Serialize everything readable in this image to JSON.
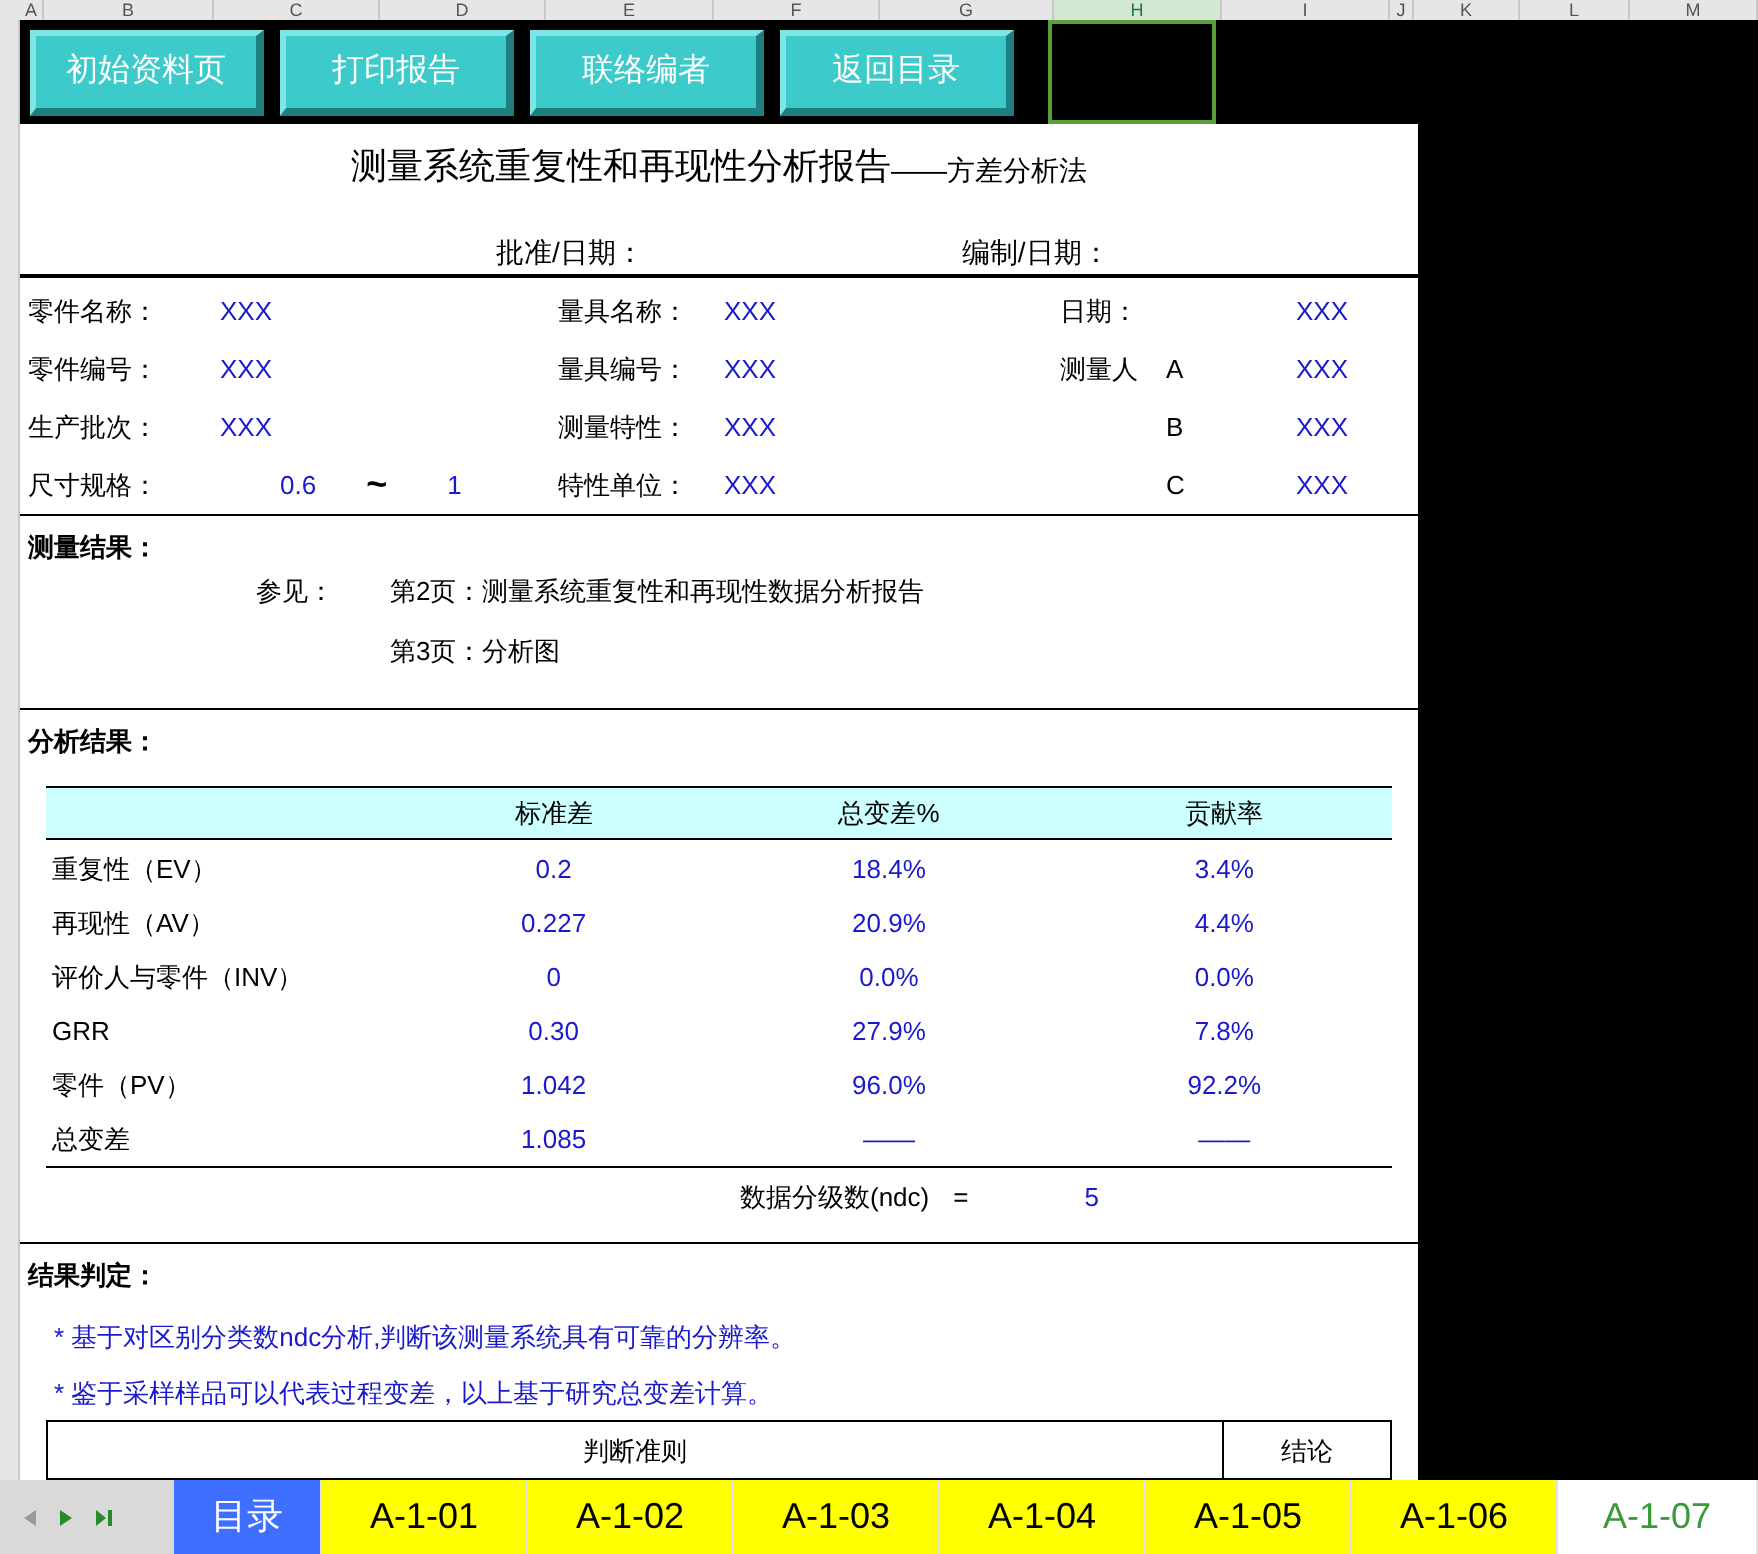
{
  "column_headers": [
    {
      "label": "A",
      "selected": false
    },
    {
      "label": "B",
      "selected": false
    },
    {
      "label": "C",
      "selected": false
    },
    {
      "label": "D",
      "selected": false
    },
    {
      "label": "E",
      "selected": false
    },
    {
      "label": "F",
      "selected": false
    },
    {
      "label": "G",
      "selected": false
    },
    {
      "label": "H",
      "selected": true
    },
    {
      "label": "I",
      "selected": false
    },
    {
      "label": "J",
      "selected": false
    },
    {
      "label": "K",
      "selected": false
    },
    {
      "label": "L",
      "selected": false
    },
    {
      "label": "M",
      "selected": false
    }
  ],
  "buttons": [
    "初始资料页",
    "打印报告",
    "联络编者",
    "返回目录"
  ],
  "title": "测量系统重复性和再现性分析报告",
  "subtitle": "——方差分析法",
  "approval": [
    "批准/日期：",
    "编制/日期："
  ],
  "info_rows": [
    {
      "left_label": "零件名称：",
      "left_value": "XXX",
      "mid_label": "量具名称：",
      "mid_value": "XXX",
      "right_label": "日期：",
      "right_value": "XXX"
    },
    {
      "left_label": "零件编号：",
      "left_value": "XXX",
      "mid_label": "量具编号：",
      "mid_value": "XXX",
      "right_label": "测量人",
      "right_sub": "A",
      "right_value": "XXX"
    },
    {
      "left_label": "生产批次：",
      "left_value": "XXX",
      "mid_label": "测量特性：",
      "mid_value": "XXX",
      "right_sub": "B",
      "right_value": "XXX"
    },
    {
      "left_label": "尺寸规格：",
      "spec_min": "0.6",
      "spec_tilde": "~",
      "spec_max": "1",
      "mid_label": "特性单位：",
      "mid_value": "XXX",
      "right_sub": "C",
      "right_value": "XXX"
    }
  ],
  "measurement_results": {
    "heading": "测量结果：",
    "see_label": "参见：",
    "pages": [
      "第2页：测量系统重复性和再现性数据分析报告",
      "第3页：分析图"
    ]
  },
  "analysis": {
    "heading": "分析结果：",
    "columns": [
      "标准差",
      "总变差%",
      "贡献率"
    ],
    "rows": [
      {
        "label": "重复性（EV）",
        "values": [
          "0.2",
          "18.4%",
          "3.4%"
        ]
      },
      {
        "label": "再现性（AV）",
        "values": [
          "0.227",
          "20.9%",
          "4.4%"
        ]
      },
      {
        "label": "评价人与零件（INV）",
        "values": [
          "0",
          "0.0%",
          "0.0%"
        ]
      },
      {
        "label": "GRR",
        "values": [
          "0.30",
          "27.9%",
          "7.8%"
        ]
      },
      {
        "label": "零件（PV）",
        "values": [
          "1.042",
          "96.0%",
          "92.2%"
        ]
      },
      {
        "label": "总变差",
        "values": [
          "1.085",
          "——",
          "——"
        ]
      }
    ],
    "ndc_label": "数据分级数(ndc)",
    "ndc_equals": "=",
    "ndc_value": "5"
  },
  "conclusion": {
    "heading": "结果判定：",
    "bullets": [
      "*  基于对区别分类数ndc分析,判断该测量系统具有可靠的分辨率。",
      "*  鉴于采样样品可以代表过程变差，以上基于研究总变差计算。"
    ],
    "criteria_columns": [
      "判断准则",
      "结论"
    ]
  },
  "sheet_tabs": [
    {
      "label": "目录",
      "color": "#3f6fff",
      "selected": false
    },
    {
      "label": "A-1-01",
      "color": "#ffff00",
      "selected": false
    },
    {
      "label": "A-1-02",
      "color": "#ffff00",
      "selected": false
    },
    {
      "label": "A-1-03",
      "color": "#ffff00",
      "selected": false
    },
    {
      "label": "A-1-04",
      "color": "#ffff00",
      "selected": false
    },
    {
      "label": "A-1-05",
      "color": "#ffff00",
      "selected": false
    },
    {
      "label": "A-1-06",
      "color": "#ffff00",
      "selected": false
    },
    {
      "label": "A-1-07",
      "color": "#ffffff",
      "selected": true
    }
  ]
}
